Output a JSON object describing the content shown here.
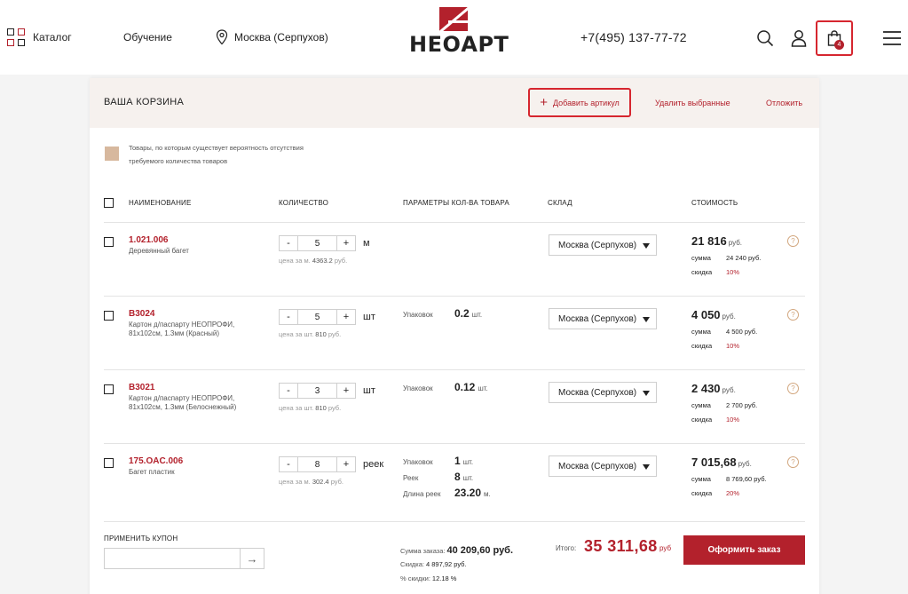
{
  "header": {
    "catalog_label": "Каталог",
    "training_label": "Обучение",
    "city_label": "Москва (Серпухов)",
    "logo_text": "НЕОАРТ",
    "phone": "+7(495) 137-77-72",
    "cart_count": "4"
  },
  "cart": {
    "title": "ВАША КОРЗИНА",
    "add_article": "Добавить артикул",
    "delete_selected": "Удалить выбранные",
    "postpone": "Отложить",
    "legend": "Товары, по которым существует вероятность отсутствия требуемого количества товаров",
    "columns": {
      "name": "НАИМЕНОВАНИЕ",
      "quantity": "КОЛИЧЕСТВО",
      "params": "ПАРАМЕТРЫ КОЛ-ВА ТОВАРА",
      "warehouse": "СКЛАД",
      "cost": "СТОИМОСТЬ"
    },
    "items": [
      {
        "code": "1.021.006",
        "name": "Деревянный багет",
        "qty": "5",
        "unit": "м",
        "unit_price_label": "цена за м.",
        "unit_price": "4363.2",
        "unit_price_cur": "руб.",
        "params": [],
        "warehouse": "Москва (Серпухов)",
        "cost": "21 816",
        "cost_cur": "руб.",
        "sum_label": "сумма",
        "sum": "24 240 руб.",
        "discount_label": "скидка",
        "discount": "10%"
      },
      {
        "code": "B3024",
        "name": "Картон д/паспарту НЕОПРОФИ, 81x102см, 1.3мм (Красный)",
        "qty": "5",
        "unit": "шт",
        "unit_price_label": "цена за шт.",
        "unit_price": "810",
        "unit_price_cur": "руб.",
        "params": [
          {
            "label": "Упаковок",
            "value": "0.2",
            "unit": "шт."
          }
        ],
        "warehouse": "Москва (Серпухов)",
        "cost": "4 050",
        "cost_cur": "руб.",
        "sum_label": "сумма",
        "sum": "4 500 руб.",
        "discount_label": "скидка",
        "discount": "10%"
      },
      {
        "code": "B3021",
        "name": "Картон д/паспарту НЕОПРОФИ, 81x102см, 1.3мм (Белоснежный)",
        "qty": "3",
        "unit": "шт",
        "unit_price_label": "цена за шт.",
        "unit_price": "810",
        "unit_price_cur": "руб.",
        "params": [
          {
            "label": "Упаковок",
            "value": "0.12",
            "unit": "шт."
          }
        ],
        "warehouse": "Москва (Серпухов)",
        "cost": "2 430",
        "cost_cur": "руб.",
        "sum_label": "сумма",
        "sum": "2 700 руб.",
        "discount_label": "скидка",
        "discount": "10%"
      },
      {
        "code": "175.OAC.006",
        "name": "Багет пластик",
        "qty": "8",
        "unit": "реек",
        "unit_price_label": "цена за м.",
        "unit_price": "302.4",
        "unit_price_cur": "руб.",
        "params": [
          {
            "label": "Упаковок",
            "value": "1",
            "unit": "шт."
          },
          {
            "label": "Реек",
            "value": "8",
            "unit": "шт."
          },
          {
            "label": "Длина реек",
            "value": "23.20",
            "unit": "м."
          }
        ],
        "warehouse": "Москва (Серпухов)",
        "cost": "7 015,68",
        "cost_cur": "руб.",
        "sum_label": "сумма",
        "sum": "8 769,60 руб.",
        "discount_label": "скидка",
        "discount": "20%"
      }
    ],
    "footer": {
      "coupon_label": "ПРИМЕНИТЬ КУПОН",
      "coupon_value": "",
      "order_sum_label": "Сумма заказа:",
      "order_sum": "40 209,60 руб.",
      "discount_label": "Скидка:",
      "discount": "4 897,92 руб.",
      "discount_pct_label": "% скидки:",
      "discount_pct": "12.18 %",
      "total_label": "Итого:",
      "total": "35 311,68",
      "total_cur": "руб",
      "order_button": "Оформить заказ"
    }
  }
}
